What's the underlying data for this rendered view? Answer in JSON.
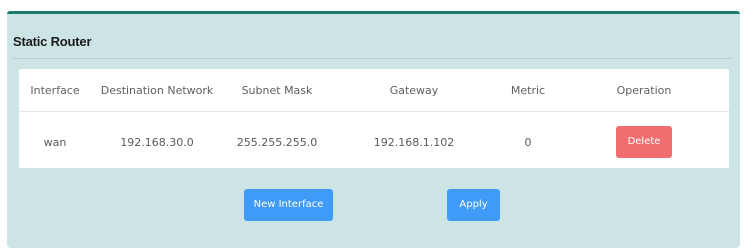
{
  "panel": {
    "title": "Static Router"
  },
  "table": {
    "headers": {
      "interface": "Interface",
      "destination": "Destination Network",
      "subnet": "Subnet Mask",
      "gateway": "Gateway",
      "metric": "Metric",
      "operation": "Operation"
    },
    "rows": [
      {
        "interface": "wan",
        "destination": "192.168.30.0",
        "subnet": "255.255.255.0",
        "gateway": "192.168.1.102",
        "metric": "0",
        "delete_label": "Delete"
      }
    ]
  },
  "actions": {
    "new_interface_label": "New Interface",
    "apply_label": "Apply"
  },
  "colors": {
    "panel_bg": "#cde4e5",
    "accent_top": "#1e7a70",
    "primary_button": "#3f9bf7",
    "danger_button": "#f26d6d"
  }
}
